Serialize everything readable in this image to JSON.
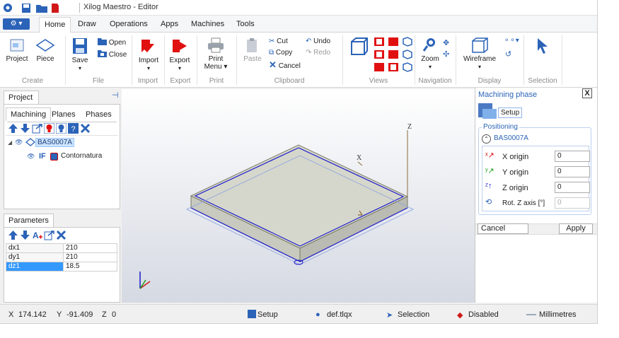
{
  "window": {
    "title": "Xilog Maestro - Editor"
  },
  "menu": {
    "app_button": "⚙ ▾",
    "tabs": [
      "Home",
      "Draw",
      "Operations",
      "Apps",
      "Machines",
      "Tools"
    ],
    "active_tab": "Home"
  },
  "ribbon": {
    "create": {
      "label": "Create",
      "project": "Project",
      "piece": "Piece"
    },
    "file": {
      "label": "File",
      "save": "Save",
      "open": "Open",
      "close": "Close"
    },
    "import": {
      "label": "Import",
      "import": "Import"
    },
    "export": {
      "label": "Export",
      "export": "Export"
    },
    "print": {
      "label": "Print",
      "print_line1": "Print",
      "print_line2": "Menu ▾"
    },
    "clipboard": {
      "label": "Clipboard",
      "paste": "Paste",
      "cut": "Cut",
      "copy": "Copy",
      "cancel": "Cancel",
      "undo": "Undo",
      "redo": "Redo"
    },
    "views": {
      "label": "Views"
    },
    "navigation": {
      "label": "Navigation",
      "zoom": "Zoom"
    },
    "display": {
      "label": "Display",
      "wireframe": "Wireframe"
    },
    "selection": {
      "label": "Selection"
    }
  },
  "project_panel": {
    "title": "Project",
    "tabs": [
      "Machining",
      "Planes",
      "Phases"
    ],
    "active_tab": "Machining",
    "tree": {
      "root": "BAS0007A",
      "child_prefix": "IF",
      "child": "Contornatura"
    }
  },
  "parameters_panel": {
    "title": "Parameters",
    "rows": [
      {
        "name": "dx1",
        "value": "210"
      },
      {
        "name": "dy1",
        "value": "210"
      },
      {
        "name": "dz1",
        "value": "18.5"
      }
    ]
  },
  "viewport": {
    "axis_z": "Z",
    "axis_x": "X"
  },
  "machining_phase": {
    "title": "Machining phase",
    "close": "X",
    "setup_label": "Setup",
    "positioning": {
      "group_label": "Positioning",
      "piece": "BAS0007A",
      "fields": [
        {
          "label": "X origin",
          "value": "0",
          "enabled": true
        },
        {
          "label": "Y origin",
          "value": "0",
          "enabled": true
        },
        {
          "label": "Z origin",
          "value": "0",
          "enabled": true
        },
        {
          "label": "Rot. Z axis [°]",
          "value": "0",
          "enabled": false
        }
      ]
    },
    "cancel": "Cancel",
    "apply": "Apply"
  },
  "status": {
    "x_label": "X",
    "x_value": "174.142",
    "y_label": "Y",
    "y_value": "-91.409",
    "z_label": "Z",
    "z_value": "0",
    "setup": "Setup",
    "file": "def.tlqx",
    "selection": "Selection",
    "disabled": "Disabled",
    "units": "Millimetres"
  },
  "colors": {
    "accent": "#2b63b8",
    "cut_red": "#e01010",
    "selected_row": "#3399ff",
    "panel_border": "#c8c8c8"
  }
}
